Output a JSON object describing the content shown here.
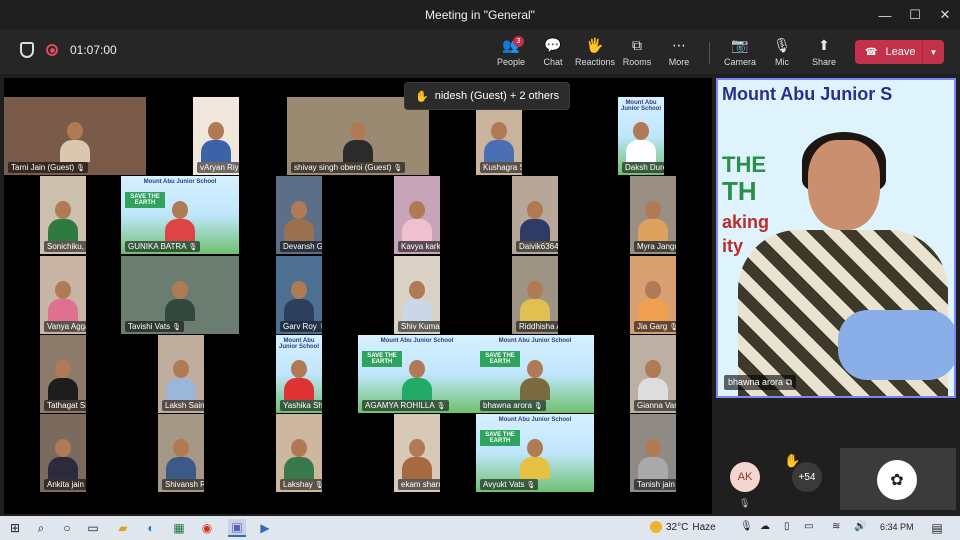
{
  "window": {
    "title": "Meeting in \"General\"",
    "minimize": "—",
    "maximize": "☐",
    "close": "✕"
  },
  "toolbar": {
    "timer": "01:07:00",
    "people_badge": "3",
    "buttons": [
      {
        "label": "People",
        "icon": "people-icon",
        "glyph": "👥"
      },
      {
        "label": "Chat",
        "icon": "chat-icon",
        "glyph": "💬"
      },
      {
        "label": "Reactions",
        "icon": "reactions-icon",
        "glyph": "🖐"
      },
      {
        "label": "Rooms",
        "icon": "rooms-icon",
        "glyph": "⧉"
      },
      {
        "label": "More",
        "icon": "more-icon",
        "glyph": "⋯"
      },
      {
        "label": "Camera",
        "icon": "camera-off-icon",
        "glyph": "📷"
      },
      {
        "label": "Mic",
        "icon": "mic-icon",
        "glyph": "🎙"
      },
      {
        "label": "Share",
        "icon": "share-icon",
        "glyph": "⬆"
      }
    ],
    "leave_label": "Leave"
  },
  "raise_hand_notice": "nidesh (Guest) + 2 others",
  "participants": [
    {
      "name": "Tarni Jain (Guest)"
    },
    {
      "name": "vAryan Riyal"
    },
    {
      "name": "shivay singh oberoi (Guest)"
    },
    {
      "name": "Kushagra Sharma"
    },
    {
      "name": "Daksh Dureja"
    },
    {
      "name": "Sonichiku, Aaditya"
    },
    {
      "name": "GUNIKA BATRA"
    },
    {
      "name": "Devansh Gupta"
    },
    {
      "name": "Kavya karki"
    },
    {
      "name": "Daivik6364"
    },
    {
      "name": "Myra  Jangra"
    },
    {
      "name": "Vanya Aggarwal"
    },
    {
      "name": "Tavishi Vats"
    },
    {
      "name": "Garv Roy"
    },
    {
      "name": "Shiv Kumar arora"
    },
    {
      "name": "Riddhisha Anand"
    },
    {
      "name": "Jia Garg"
    },
    {
      "name": "Tathagat Shom"
    },
    {
      "name": "Laksh  Saini"
    },
    {
      "name": "Yashika Sharma"
    },
    {
      "name": "AGAMYA ROHILLA"
    },
    {
      "name": "bhawna arora"
    },
    {
      "name": "Gianna Varghese"
    },
    {
      "name": "Ankita jain"
    },
    {
      "name": "Shivansh Rajput"
    },
    {
      "name": "Lakshay"
    },
    {
      "name": "ekam sharma"
    },
    {
      "name": "Avyukt Vats"
    },
    {
      "name": "Tanish jain"
    }
  ],
  "poster": {
    "school": "Mount Abu Junior School",
    "headline": "SAVE THE EARTH",
    "sub": "Paper Making Activity"
  },
  "spotlight": {
    "name": "bhawna arora",
    "poster_school": "Mount Abu Junior S",
    "poster_line1": "THE",
    "poster_line2": "TH",
    "poster_line3": "aking",
    "poster_line4": "ity"
  },
  "overflow": {
    "avatar_initials": "AK",
    "more_count": "+54"
  },
  "taskbar": {
    "temperature": "32°C",
    "condition": "Haze",
    "time": "6:34 PM"
  }
}
